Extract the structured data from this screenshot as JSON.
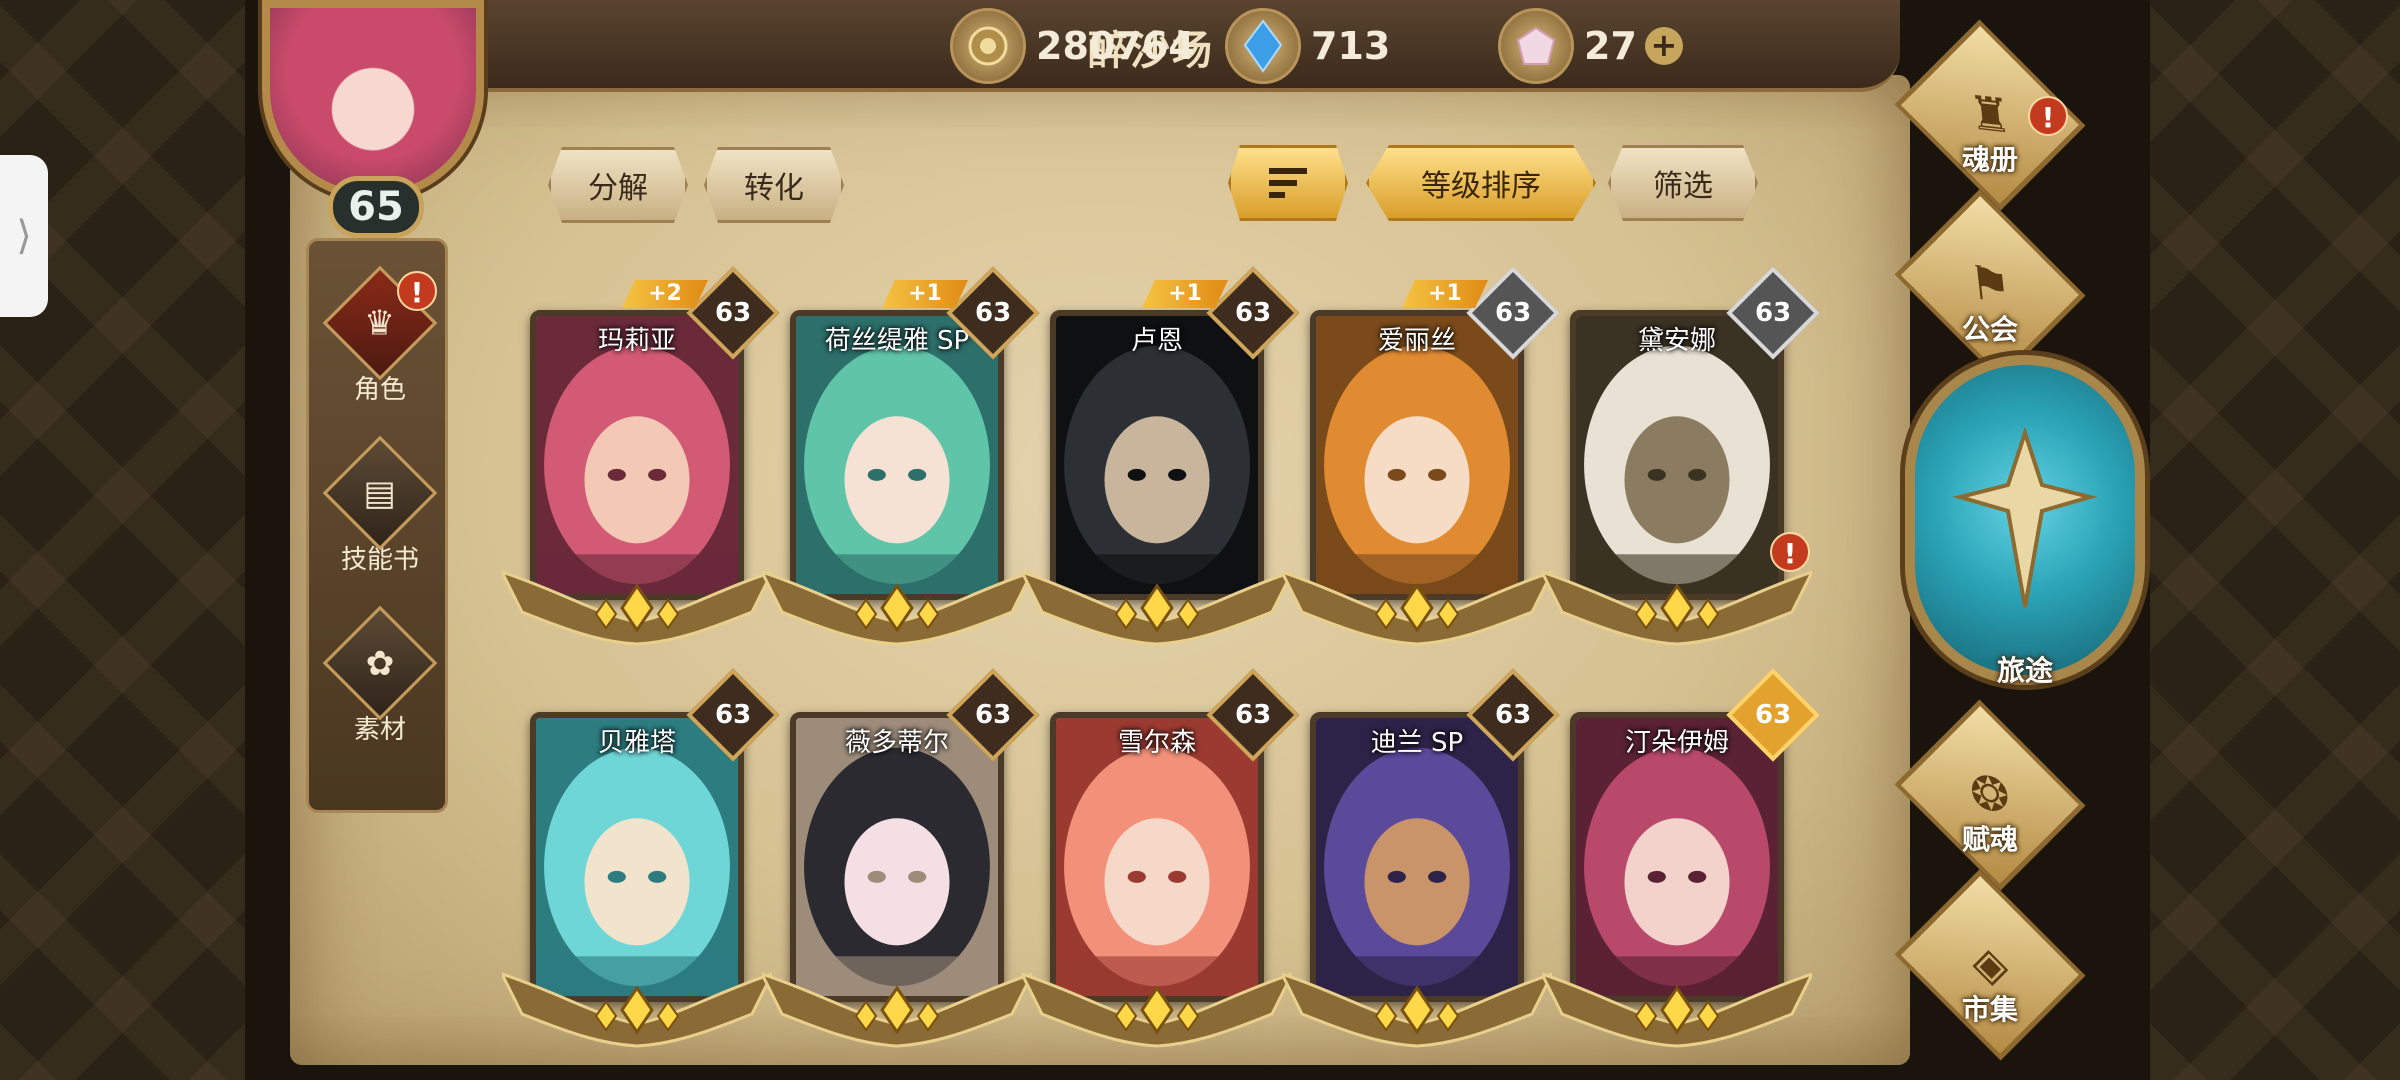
{
  "header": {
    "title": "醉沙场",
    "gold": "280764",
    "crystal": "713",
    "gem": "27",
    "plus_label": "+"
  },
  "player": {
    "level": "65"
  },
  "left_nav": [
    {
      "label": "角色",
      "icon": "character-icon",
      "alert": "!"
    },
    {
      "label": "技能书",
      "icon": "skillbook-icon"
    },
    {
      "label": "素材",
      "icon": "material-icon"
    }
  ],
  "toolbar": {
    "decompose": "分解",
    "convert": "转化",
    "sort_icon": "sort-icon",
    "level_sort": "等级排序",
    "filter": "筛选"
  },
  "cards": [
    {
      "name": "玛莉亚",
      "level": "63",
      "plus": "+2",
      "lvl_style": "bronze",
      "colors": [
        "#d35a74",
        "#f3c9b5",
        "#6a2a3a"
      ]
    },
    {
      "name": "荷丝缇雅 SP",
      "level": "63",
      "plus": "+1",
      "lvl_style": "bronze",
      "colors": [
        "#5fc4a8",
        "#f5e2d5",
        "#2d6f6b"
      ]
    },
    {
      "name": "卢恩",
      "level": "63",
      "plus": "+1",
      "lvl_style": "bronze",
      "colors": [
        "#2c2f34",
        "#c9b49c",
        "#0f1012"
      ]
    },
    {
      "name": "爱丽丝",
      "level": "63",
      "plus": "+1",
      "lvl_style": "silver",
      "colors": [
        "#e08a32",
        "#f6dcc4",
        "#7a4a1a"
      ]
    },
    {
      "name": "黛安娜",
      "level": "63",
      "plus": "",
      "lvl_style": "silver",
      "colors": [
        "#e8e2d4",
        "#8b7b60",
        "#3a3222"
      ],
      "alert": "!"
    },
    {
      "name": "贝雅塔",
      "level": "63",
      "plus": "",
      "lvl_style": "bronze",
      "colors": [
        "#6fd6d8",
        "#f2e4cc",
        "#2c7c80"
      ]
    },
    {
      "name": "薇多蒂尔",
      "level": "63",
      "plus": "",
      "lvl_style": "bronze",
      "colors": [
        "#2a2a30",
        "#f3dfe4",
        "#9d8c7a"
      ]
    },
    {
      "name": "雪尔森",
      "level": "63",
      "plus": "",
      "lvl_style": "bronze",
      "colors": [
        "#f2907a",
        "#f6d8c8",
        "#9a3a30"
      ]
    },
    {
      "name": "迪兰 SP",
      "level": "63",
      "plus": "",
      "lvl_style": "bronze",
      "colors": [
        "#5b4a9a",
        "#c9946a",
        "#2d2348"
      ]
    },
    {
      "name": "汀朵伊姆",
      "level": "63",
      "plus": "",
      "lvl_style": "gold",
      "colors": [
        "#b8496a",
        "#f3d2cc",
        "#5a2234"
      ]
    }
  ],
  "right_nav": [
    {
      "label": "魂册",
      "icon": "soulbook-icon",
      "alert": "!"
    },
    {
      "label": "公会",
      "icon": "guild-icon"
    },
    {
      "label": "旅途",
      "icon": "journey-icon"
    },
    {
      "label": "赋魂",
      "icon": "soul-infuse-icon"
    },
    {
      "label": "市集",
      "icon": "market-icon"
    }
  ],
  "colors": {
    "parchment": "#d6c192",
    "journey_teal": "#2aa3b7",
    "alert_red": "#c33a1e",
    "gold_accent": "#e3a22e"
  }
}
